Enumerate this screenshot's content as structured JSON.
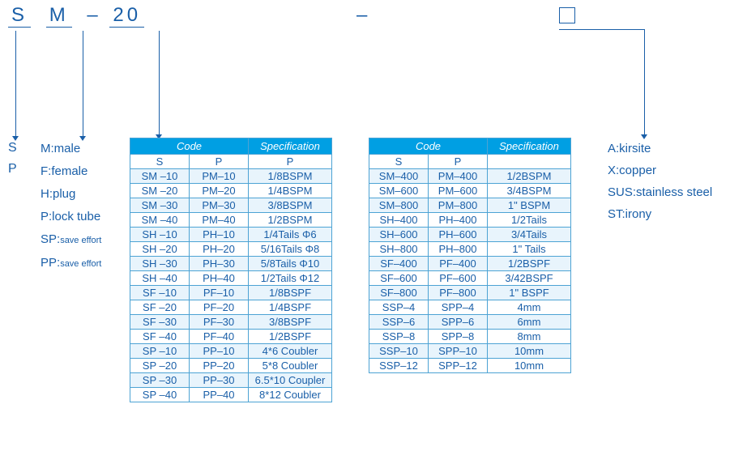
{
  "top_code": {
    "p1": "S",
    "p2": "M",
    "sep1": "–",
    "p3": "20",
    "sep2": "–"
  },
  "col1": [
    "S",
    "P"
  ],
  "col2": [
    {
      "k": "M",
      "v": "male"
    },
    {
      "k": "F",
      "v": "female"
    },
    {
      "k": "H",
      "v": "plug"
    },
    {
      "k": "P",
      "v": "lock tube"
    },
    {
      "k": "SP",
      "v": "save effort",
      "small": true
    },
    {
      "k": "PP",
      "v": "save effort",
      "small": true
    }
  ],
  "right": [
    {
      "k": "A",
      "v": "kirsite"
    },
    {
      "k": "X",
      "v": "copper"
    },
    {
      "k": "SUS",
      "v": "stainless steel"
    },
    {
      "k": "ST",
      "v": "irony"
    }
  ],
  "table_headers": {
    "code": "Code",
    "spec": "Specification",
    "s": "S",
    "p": "P"
  },
  "table1": [
    [
      "SM –10",
      "PM–10",
      "1/8BSPM"
    ],
    [
      "SM –20",
      "PM–20",
      "1/4BSPM"
    ],
    [
      "SM –30",
      "PM–30",
      "3/8BSPM"
    ],
    [
      "SM –40",
      "PM–40",
      "1/2BSPM"
    ],
    [
      "SH –10",
      "PH–10",
      "1/4Tails  Φ6"
    ],
    [
      "SH –20",
      "PH–20",
      "5/16Tails  Φ8"
    ],
    [
      "SH –30",
      "PH–30",
      "5/8Tails  Φ10"
    ],
    [
      "SH –40",
      "PH–40",
      "1/2Tails  Φ12"
    ],
    [
      "SF –10",
      "PF–10",
      "1/8BSPF"
    ],
    [
      "SF –20",
      "PF–20",
      "1/4BSPF"
    ],
    [
      "SF –30",
      "PF–30",
      "3/8BSPF"
    ],
    [
      "SF –40",
      "PF–40",
      "1/2BSPF"
    ],
    [
      "SP –10",
      "PP–10",
      "4*6 Coubler"
    ],
    [
      "SP –20",
      "PP–20",
      "5*8 Coubler"
    ],
    [
      "SP –30",
      "PP–30",
      "6.5*10 Coupler"
    ],
    [
      "SP –40",
      "PP–40",
      "8*12 Coubler"
    ]
  ],
  "table2": [
    [
      "SM–400",
      "PM–400",
      "1/2BSPM"
    ],
    [
      "SM–600",
      "PM–600",
      "3/4BSPM"
    ],
    [
      "SM–800",
      "PM–800",
      "1\"  BSPM"
    ],
    [
      "SH–400",
      "PH–400",
      "1/2Tails"
    ],
    [
      "SH–600",
      "PH–600",
      "3/4Tails"
    ],
    [
      "SH–800",
      "PH–800",
      "1\"  Tails"
    ],
    [
      "SF–400",
      "PF–400",
      "1/2BSPF"
    ],
    [
      "SF–600",
      "PF–600",
      "3/42BSPF"
    ],
    [
      "SF–800",
      "PF–800",
      "1\"  BSPF"
    ],
    [
      "SSP–4",
      "SPP–4",
      "4mm"
    ],
    [
      "SSP–6",
      "SPP–6",
      "6mm"
    ],
    [
      "SSP–8",
      "SPP–8",
      "8mm"
    ],
    [
      "SSP–10",
      "SPP–10",
      "10mm"
    ],
    [
      "SSP–12",
      "SPP–12",
      "10mm"
    ]
  ]
}
